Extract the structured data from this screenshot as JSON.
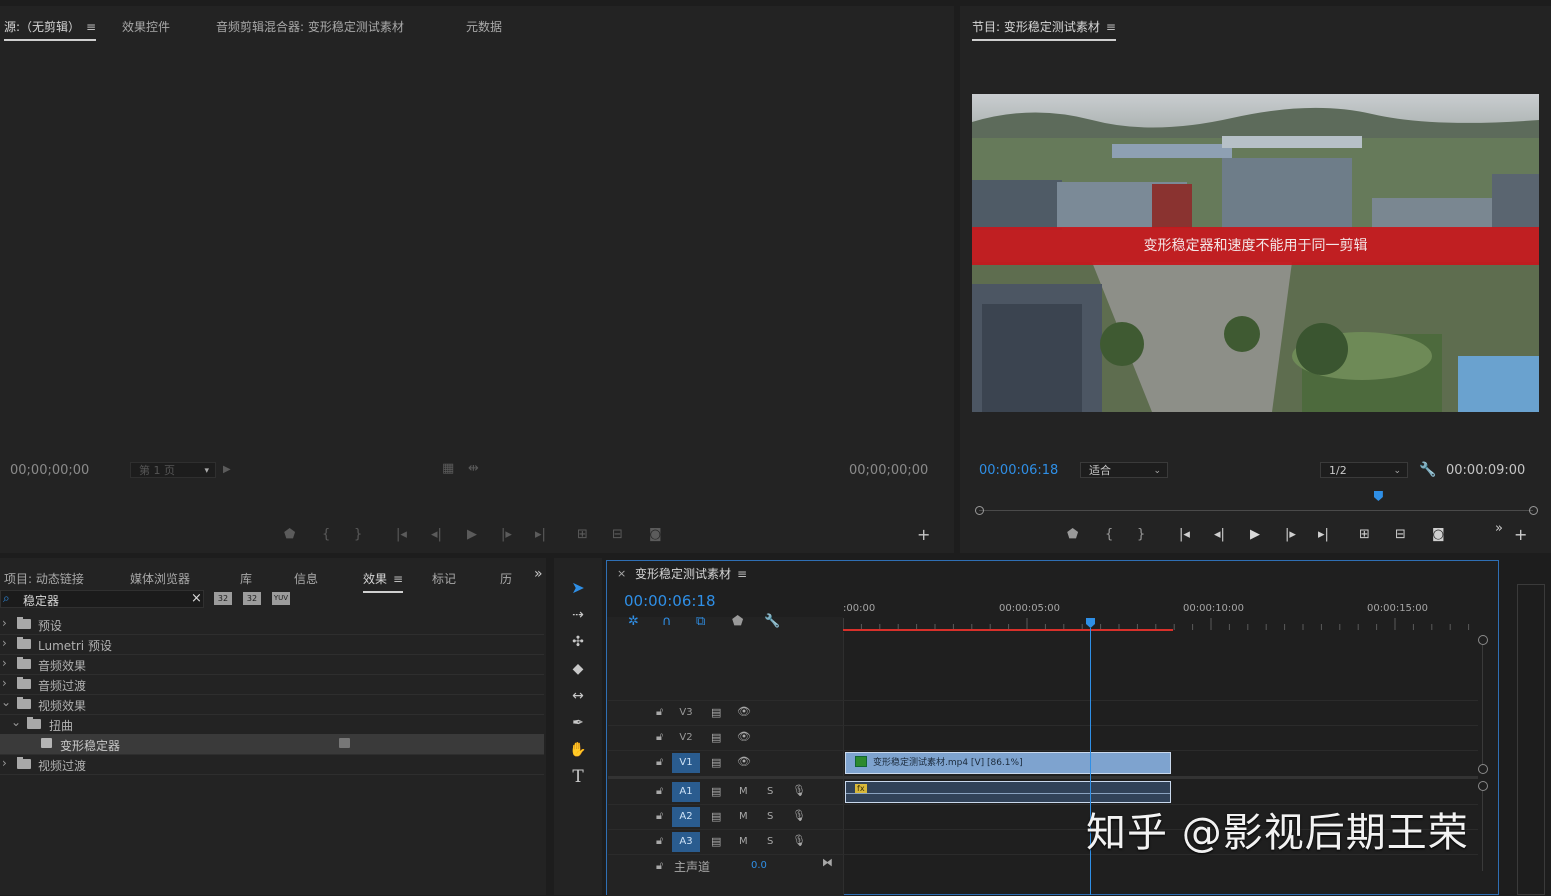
{
  "source_panel": {
    "tabs": [
      {
        "label": "源:（无剪辑）"
      },
      {
        "label": "效果控件"
      },
      {
        "label": "音频剪辑混合器: 变形稳定测试素材"
      },
      {
        "label": "元数据"
      }
    ],
    "timecode_left": "00;00;00;00",
    "timecode_right": "00;00;00;00",
    "page_select": "第 1 页"
  },
  "program_panel": {
    "title": "节目: 变形稳定测试素材",
    "caption": "变形稳定器和速度不能用于同一剪辑",
    "timecode_current": "00:00:06:18",
    "fit_select": "适合",
    "resolution_select": "1/2",
    "timecode_duration": "00:00:09:00",
    "playhead_fraction": 0.72
  },
  "project_panel": {
    "tabs": [
      {
        "label": "项目: 动态链接"
      },
      {
        "label": "媒体浏览器"
      },
      {
        "label": "库"
      },
      {
        "label": "信息"
      },
      {
        "label": "效果"
      },
      {
        "label": "标记"
      },
      {
        "label": "历"
      }
    ],
    "search_value": "稳定器",
    "filter_icons": [
      "32",
      "32",
      "YUV"
    ],
    "tree": [
      {
        "label": "预设"
      },
      {
        "label": "Lumetri 预设"
      },
      {
        "label": "音频效果"
      },
      {
        "label": "音频过渡"
      },
      {
        "label": "视频效果"
      },
      {
        "label": "扭曲"
      },
      {
        "label": "变形稳定器"
      },
      {
        "label": "视频过渡"
      }
    ]
  },
  "timeline": {
    "sequence_name": "变形稳定测试素材",
    "timecode": "00:00:06:18",
    "ruler_labels": [
      ":00:00",
      "00:00:05:00",
      "00:00:10:00",
      "00:00:15:00"
    ],
    "tracks": {
      "video": [
        "V3",
        "V2",
        "V1"
      ],
      "audio": [
        "A1",
        "A2",
        "A3"
      ],
      "mute_label": "M",
      "solo_label": "S",
      "master_label": "主声道",
      "master_value": "0.0"
    },
    "clip_label": "变形稳定测试素材.mp4 [V] [86.1%]",
    "fx_badge": "fx"
  },
  "watermark": "知乎 @影视后期王荣",
  "colors": {
    "accent_blue": "#2f8fe6",
    "banner_red": "#c8171c",
    "clip_blue": "#7ea3cf",
    "in_out_red": "#d8302a"
  }
}
